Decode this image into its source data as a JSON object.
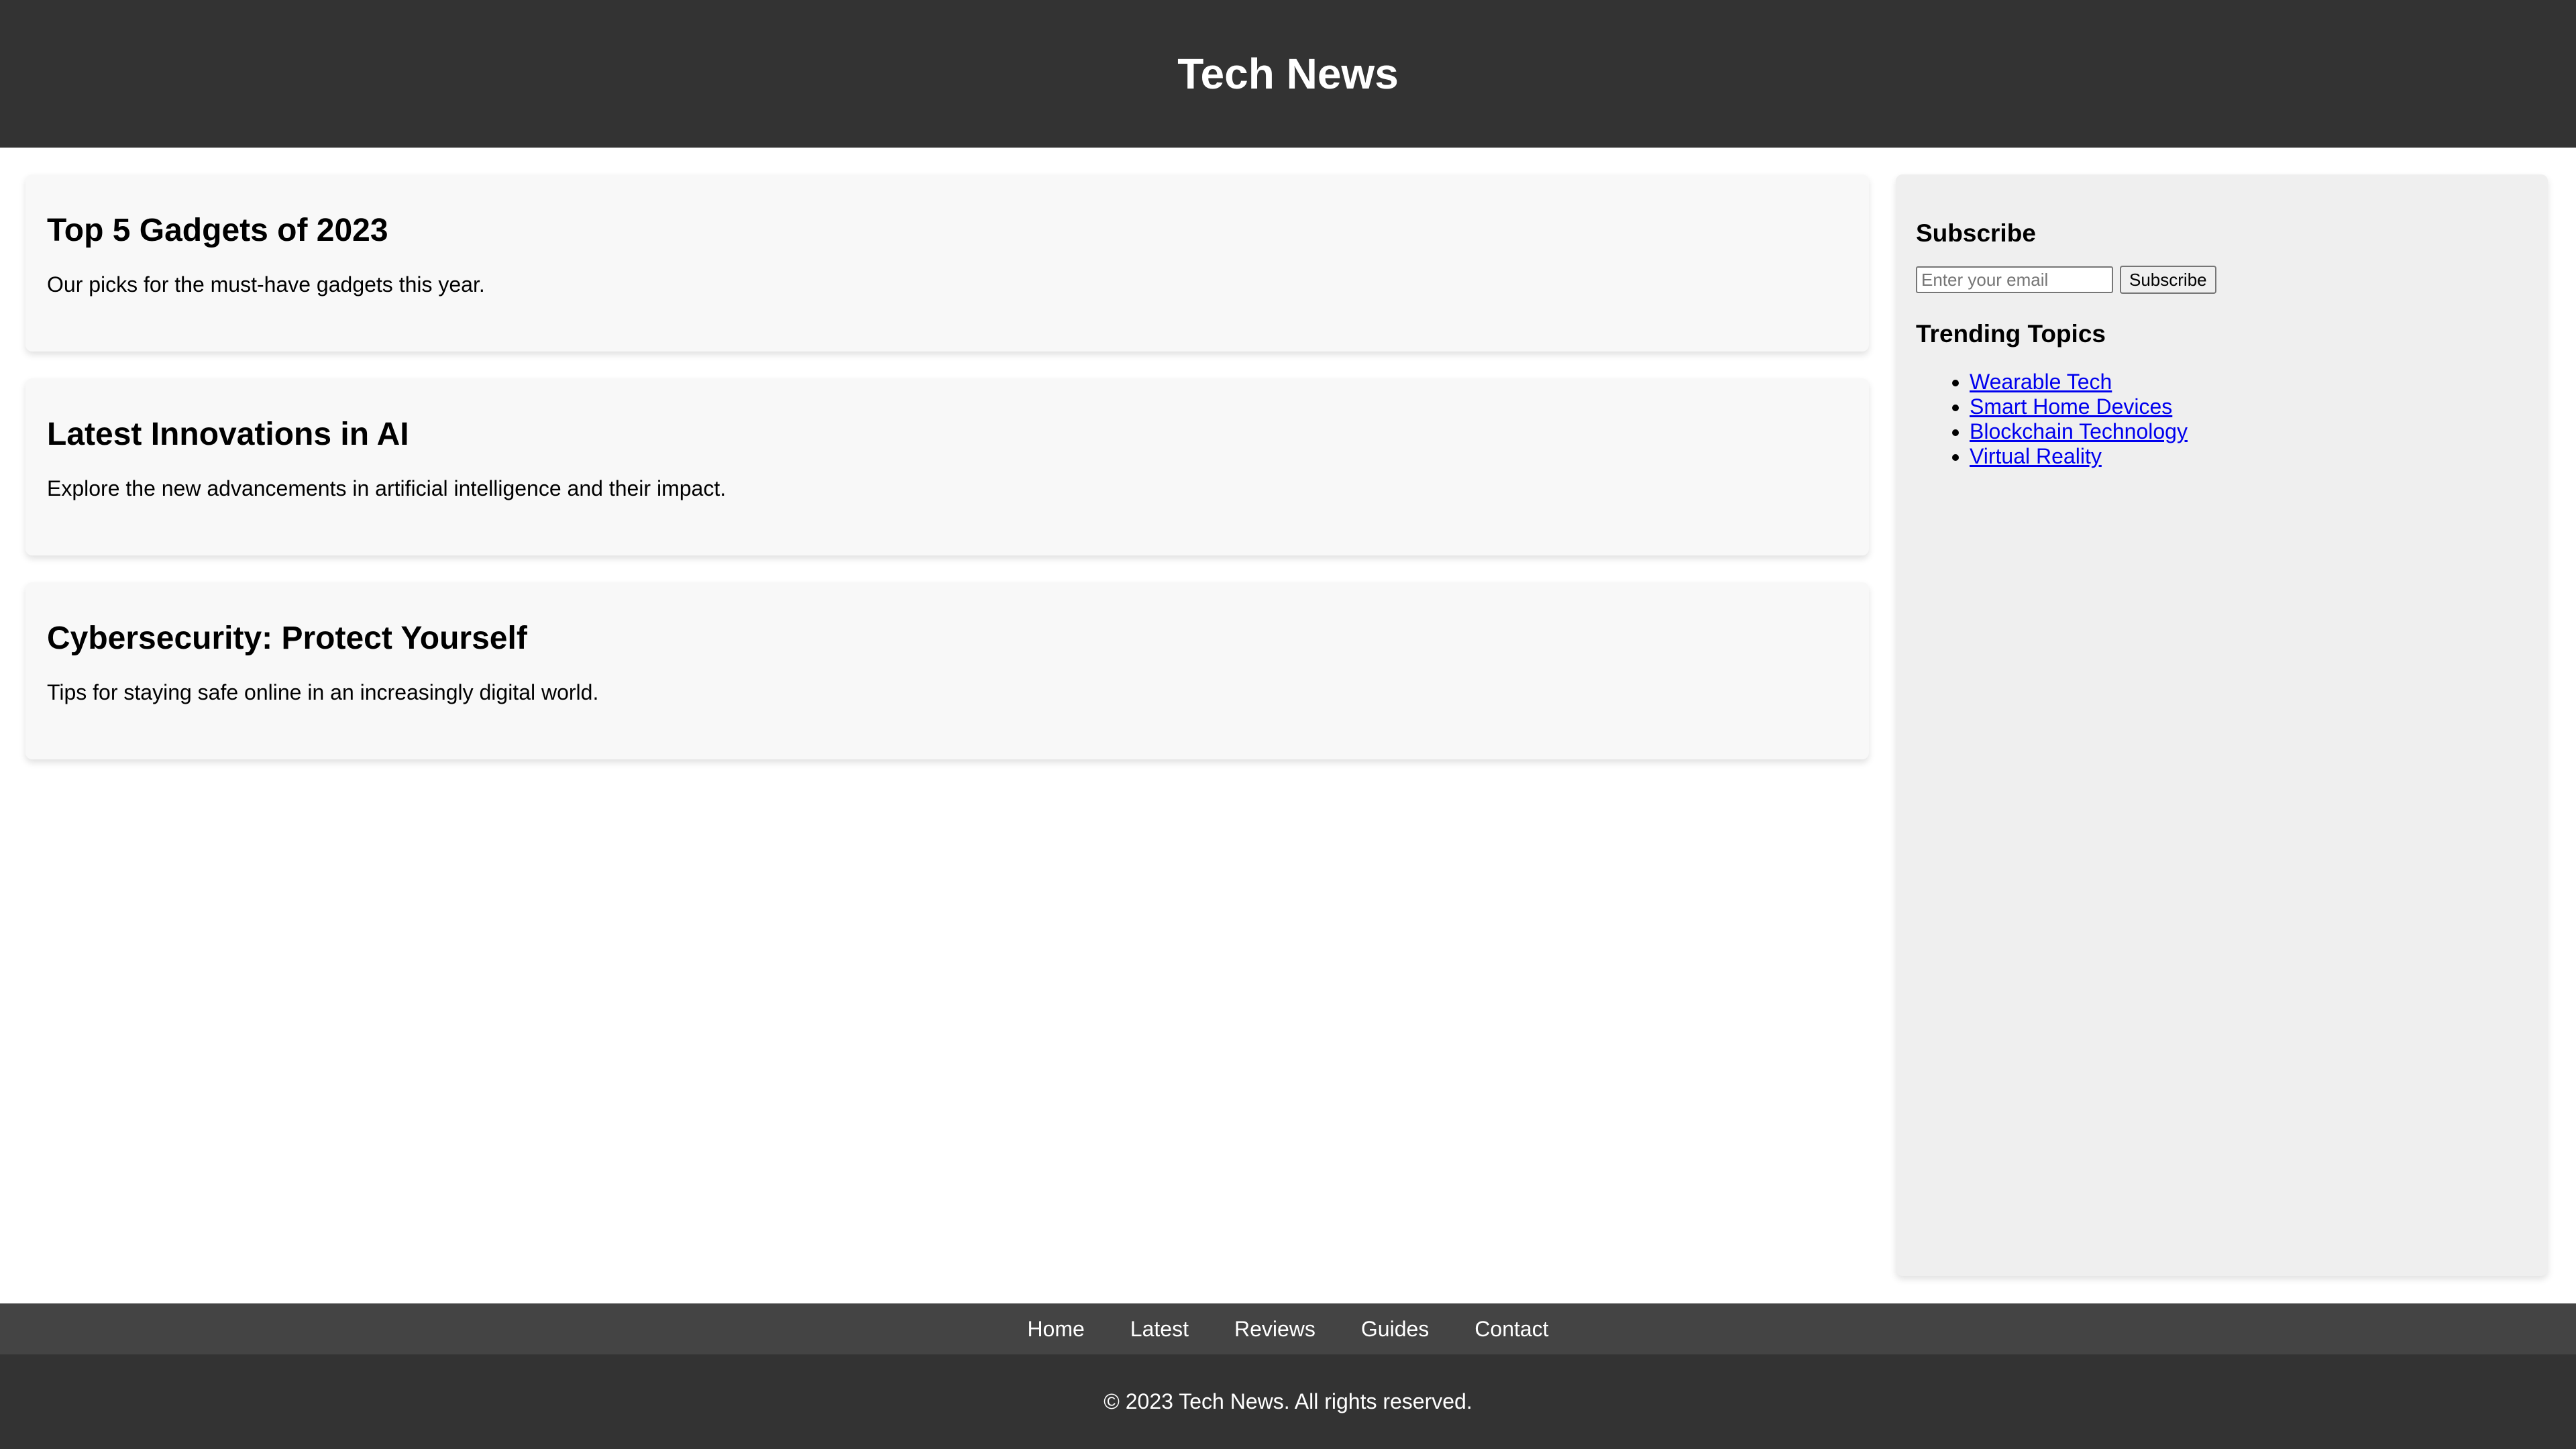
{
  "header": {
    "title": "Tech News"
  },
  "articles": [
    {
      "title": "Top 5 Gadgets of 2023",
      "summary": "Our picks for the must-have gadgets this year."
    },
    {
      "title": "Latest Innovations in AI",
      "summary": "Explore the new advancements in artificial intelligence and their impact."
    },
    {
      "title": "Cybersecurity: Protect Yourself",
      "summary": "Tips for staying safe online in an increasingly digital world."
    }
  ],
  "sidebar": {
    "subscribe_title": "Subscribe",
    "email_placeholder": "Enter your email",
    "email_value": "",
    "subscribe_button": "Subscribe",
    "trending_title": "Trending Topics",
    "topics": [
      "Wearable Tech",
      "Smart Home Devices",
      "Blockchain Technology",
      "Virtual Reality"
    ]
  },
  "nav": {
    "items": [
      "Home",
      "Latest",
      "Reviews",
      "Guides",
      "Contact"
    ]
  },
  "footer": {
    "copyright": "© 2023 Tech News. All rights reserved."
  },
  "colors": {
    "header_bg": "#333333",
    "nav_bg": "#444444",
    "card_bg": "#f8f8f8",
    "sidebar_bg": "#efefef",
    "link": "#0000ee"
  }
}
